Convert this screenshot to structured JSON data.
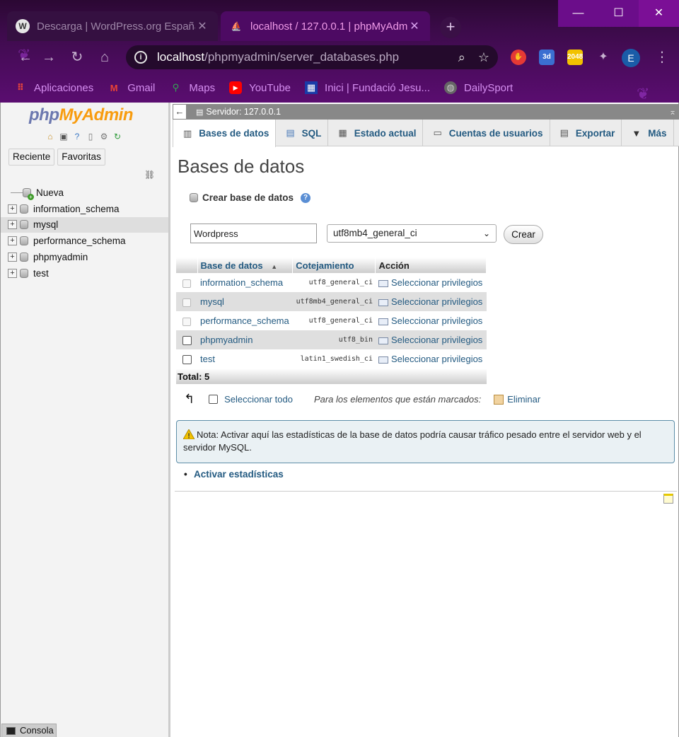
{
  "browser": {
    "tabs": [
      {
        "title": "Descarga | WordPress.org España",
        "close": "✕"
      },
      {
        "title": "localhost / 127.0.0.1 | phpMyAdmin",
        "close": "✕"
      }
    ],
    "new_tab": "+",
    "window_controls": {
      "minimize": "—",
      "maximize": "☐",
      "close": "✕"
    },
    "url_host": "localhost",
    "url_path": "/phpmyadmin/server_databases.php",
    "profile_initial": "E",
    "bookmarks": [
      "Aplicaciones",
      "Gmail",
      "Maps",
      "YouTube",
      "Inici | Fundació Jesu...",
      "DailySport"
    ]
  },
  "nav": {
    "logo_php": "php",
    "logo_myadmin": "MyAdmin",
    "btn_recent": "Reciente",
    "btn_favorites": "Favoritas",
    "tree": [
      {
        "label": "Nueva"
      },
      {
        "label": "information_schema"
      },
      {
        "label": "mysql"
      },
      {
        "label": "performance_schema"
      },
      {
        "label": "phpmyadmin"
      },
      {
        "label": "test"
      }
    ]
  },
  "main": {
    "server_label": "Servidor: 127.0.0.1",
    "tabs": [
      "Bases de datos",
      "SQL",
      "Estado actual",
      "Cuentas de usuarios",
      "Exportar",
      "Más"
    ],
    "title": "Bases de datos",
    "create_label": "Crear base de datos",
    "db_name_value": "Wordpress",
    "collation_value": "utf8mb4_general_ci",
    "create_button": "Crear",
    "table": {
      "headers": [
        "Base de datos",
        "Cotejamiento",
        "Acción"
      ],
      "rows": [
        {
          "name": "information_schema",
          "collation": "utf8_general_ci",
          "action": "Seleccionar privilegios"
        },
        {
          "name": "mysql",
          "collation": "utf8mb4_general_ci",
          "action": "Seleccionar privilegios"
        },
        {
          "name": "performance_schema",
          "collation": "utf8_general_ci",
          "action": "Seleccionar privilegios"
        },
        {
          "name": "phpmyadmin",
          "collation": "utf8_bin",
          "action": "Seleccionar privilegios"
        },
        {
          "name": "test",
          "collation": "latin1_swedish_ci",
          "action": "Seleccionar privilegios"
        }
      ],
      "total": "Total: 5"
    },
    "select_all": "Seleccionar todo",
    "marked_label": "Para los elementos que están marcados:",
    "delete_label": "Eliminar",
    "notice": "Nota: Activar aquí las estadísticas de la base de datos podría causar tráfico pesado entre el servidor web y el servidor MySQL.",
    "enable_stats": "Activar estadísticas",
    "console": "Consola"
  }
}
